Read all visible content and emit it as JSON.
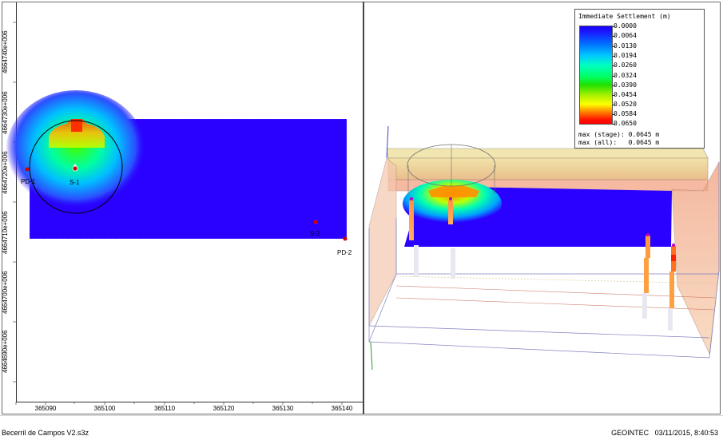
{
  "plan_view": {
    "y_ticks": [
      "4664740e+006",
      "4664730e+006",
      "4664720e+006",
      "4664710e+006",
      "4664700e+006",
      "4664690e+006"
    ],
    "x_ticks": [
      "365090",
      "365100",
      "365110",
      "365120",
      "365130",
      "365140"
    ],
    "points": [
      {
        "label": "PD-1"
      },
      {
        "label": "S-1"
      },
      {
        "label": "S-2"
      },
      {
        "label": "PD-2"
      }
    ]
  },
  "legend": {
    "title": "Immediate Settlement (m)",
    "values": [
      "0.0000",
      "0.0064",
      "0.0130",
      "0.0194",
      "0.0260",
      "0.0324",
      "0.0390",
      "0.0454",
      "0.0520",
      "0.0584",
      "0.0650"
    ],
    "max_stage_label": "max (stage):",
    "max_stage_value": "0.0645 m",
    "max_all_label": "max (all):",
    "max_all_value": "0.0645 m"
  },
  "status": {
    "file_name": "Becerril de Campos V2.s3z",
    "company": "GEOINTEC",
    "datetime": "03/11/2015, 8:40:53"
  },
  "colors": {
    "low": "#1a00ff",
    "high": "#ff0000",
    "accent": "#ffd000"
  }
}
